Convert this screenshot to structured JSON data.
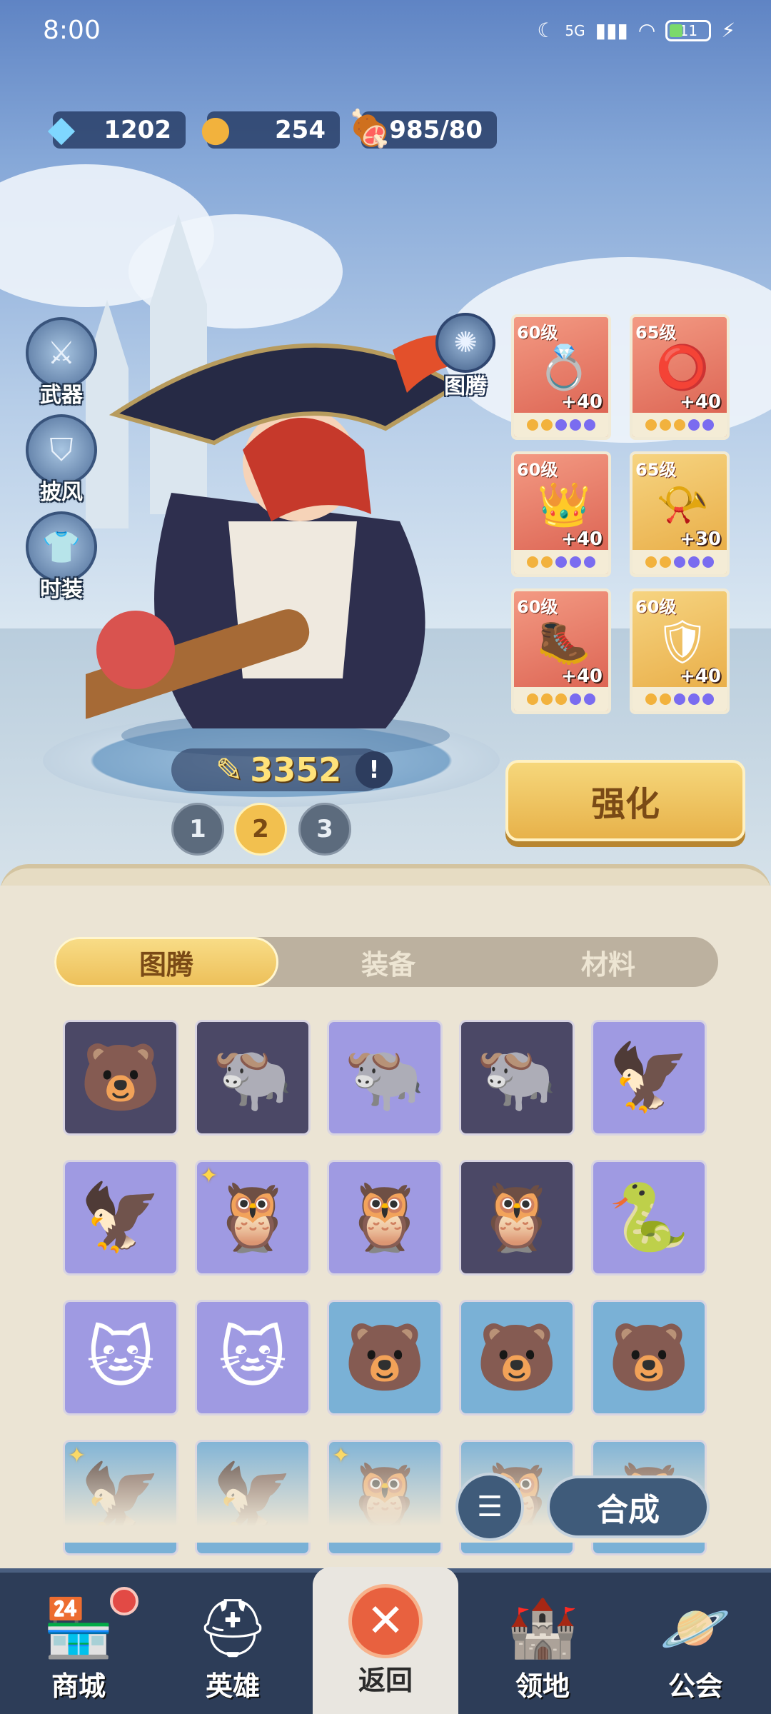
{
  "status_bar": {
    "time": "8:00",
    "network": "5G",
    "battery": "11"
  },
  "resources": [
    {
      "name": "diamond",
      "icon": "diamond-icon",
      "value": "1202"
    },
    {
      "name": "gold",
      "icon": "coin-icon",
      "value": "254"
    },
    {
      "name": "stamina",
      "icon": "meat-icon",
      "value": "985/80"
    }
  ],
  "side_buttons": [
    {
      "label": "武器",
      "icon": "weapon-icon"
    },
    {
      "label": "披风",
      "icon": "cape-icon"
    },
    {
      "label": "时装",
      "icon": "outfit-icon"
    }
  ],
  "totem_button": {
    "label": "图腾",
    "icon": "totem-icon"
  },
  "equipment_slots": [
    {
      "level": "60级",
      "bonus": "+40",
      "rarity": "red",
      "icon": "bracelet-icon"
    },
    {
      "level": "65级",
      "bonus": "+40",
      "rarity": "red",
      "icon": "ring-icon"
    },
    {
      "level": "60级",
      "bonus": "+40",
      "rarity": "red",
      "icon": "crown-icon"
    },
    {
      "level": "65级",
      "bonus": "+30",
      "rarity": "gold",
      "icon": "horn-icon"
    },
    {
      "level": "60级",
      "bonus": "+40",
      "rarity": "red",
      "icon": "boots-icon"
    },
    {
      "level": "60级",
      "bonus": "+40",
      "rarity": "gold",
      "icon": "armor-icon"
    }
  ],
  "power": {
    "value": "3352",
    "info": "!"
  },
  "pages": [
    "1",
    "2",
    "3"
  ],
  "active_page": "2",
  "strengthen_label": "强化",
  "tabs": [
    {
      "label": "图腾",
      "active": true
    },
    {
      "label": "装备",
      "active": false
    },
    {
      "label": "材料",
      "active": false
    }
  ],
  "totem_cards": [
    {
      "style": "dark",
      "icon": "bear-mask-icon",
      "glyph": "🐻",
      "star": false
    },
    {
      "style": "dark",
      "icon": "bull-mask-icon",
      "glyph": "🐃",
      "star": false
    },
    {
      "style": "purple",
      "icon": "bull-mask-icon",
      "glyph": "🐃",
      "star": false
    },
    {
      "style": "dark",
      "icon": "bull-mask-icon",
      "glyph": "🐃",
      "star": false
    },
    {
      "style": "purple",
      "icon": "eagle-mask-icon",
      "glyph": "🦅",
      "star": false
    },
    {
      "style": "purple",
      "icon": "eagle-mask-icon",
      "glyph": "🦅",
      "star": false
    },
    {
      "style": "purple",
      "icon": "owl-mask-icon",
      "glyph": "🦉",
      "star": true
    },
    {
      "style": "purple",
      "icon": "owl-mask-icon",
      "glyph": "🦉",
      "star": false
    },
    {
      "style": "dark",
      "icon": "owl-mask-icon",
      "glyph": "🦉",
      "star": false
    },
    {
      "style": "purple",
      "icon": "serpent-mask-icon",
      "glyph": "🐍",
      "star": false
    },
    {
      "style": "purple",
      "icon": "cat-mask-icon",
      "glyph": "🐱",
      "star": false
    },
    {
      "style": "purple",
      "icon": "cat-mask-icon",
      "glyph": "🐱",
      "star": false
    },
    {
      "style": "blue",
      "icon": "bear-mask-icon",
      "glyph": "🐻",
      "star": false
    },
    {
      "style": "blue",
      "icon": "bear-mask-icon",
      "glyph": "🐻",
      "star": false
    },
    {
      "style": "blue",
      "icon": "bear-mask-icon",
      "glyph": "🐻",
      "star": false
    },
    {
      "style": "blue",
      "icon": "eagle-mask-icon",
      "glyph": "🦅",
      "star": true
    },
    {
      "style": "blue",
      "icon": "eagle-mask-icon",
      "glyph": "🦅",
      "star": false
    },
    {
      "style": "blue",
      "icon": "owl-mask-icon",
      "glyph": "🦉",
      "star": true
    },
    {
      "style": "blue",
      "icon": "owl-mask-icon",
      "glyph": "🦉",
      "star": false
    },
    {
      "style": "blue",
      "icon": "owl-mask-icon",
      "glyph": "🦉",
      "star": false
    }
  ],
  "filter_icon": "filter-icon",
  "synthesize_label": "合成",
  "bottom_nav": [
    {
      "label": "商城",
      "icon": "shop-icon",
      "badge": true
    },
    {
      "label": "英雄",
      "icon": "helmet-icon",
      "badge": false
    },
    {
      "label": "返回",
      "icon": "close-icon",
      "badge": false
    },
    {
      "label": "领地",
      "icon": "castle-icon",
      "badge": false
    },
    {
      "label": "公会",
      "icon": "planet-icon",
      "badge": false
    }
  ]
}
